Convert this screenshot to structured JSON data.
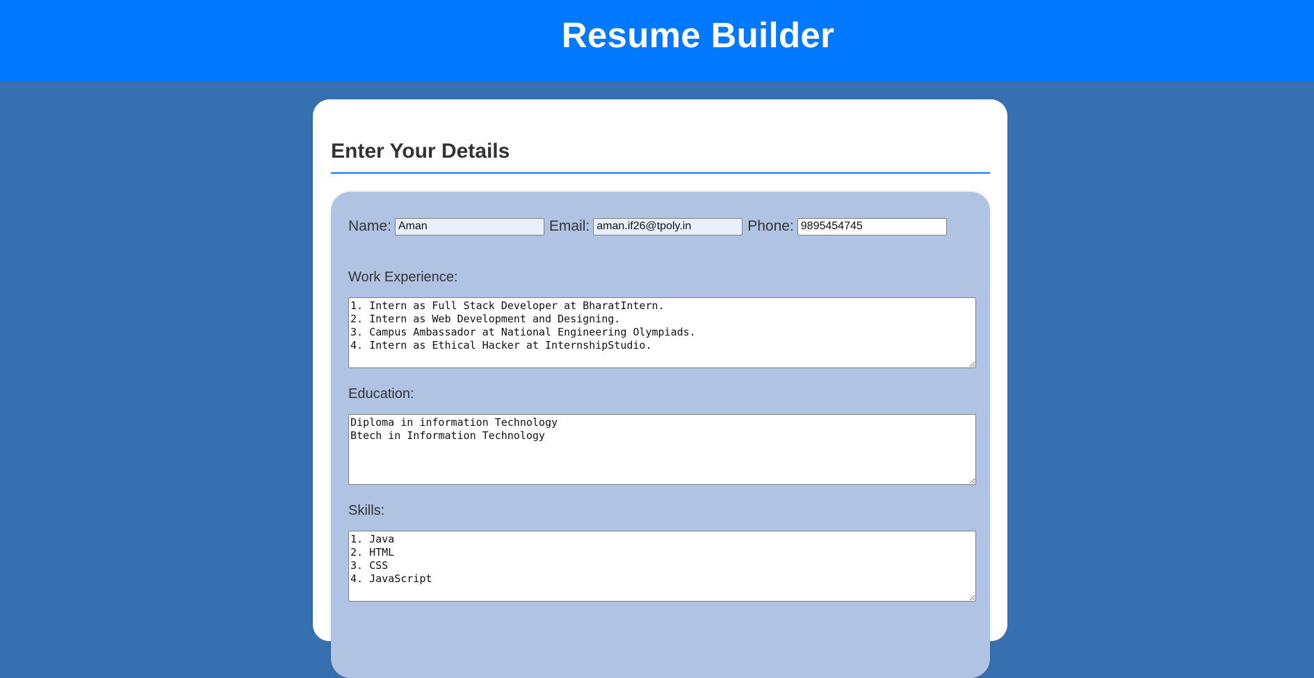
{
  "header": {
    "title": "Resume Builder"
  },
  "card": {
    "title": "Enter Your Details"
  },
  "form": {
    "name": {
      "label": "Name:",
      "value": "Aman"
    },
    "email": {
      "label": "Email:",
      "value": "aman.if26@tpoly.in"
    },
    "phone": {
      "label": "Phone:",
      "value": "9895454745"
    },
    "work_experience": {
      "label": "Work Experience:",
      "value": "1. Intern as Full Stack Developer at BharatIntern.\n2. Intern as Web Development and Designing.\n3. Campus Ambassador at National Engineering Olympiads.\n4. Intern as Ethical Hacker at InternshipStudio."
    },
    "education": {
      "label": "Education:",
      "value": "Diploma in information Technology\nBtech in Information Technology"
    },
    "skills": {
      "label": "Skills:",
      "value": "1. Java\n2. HTML\n3. CSS\n4. JavaScript"
    }
  },
  "colors": {
    "header_bg": "#0078ff",
    "page_bg": "#3670b0",
    "panel_bg": "#b1c3e2",
    "accent_rule": "#0078ff",
    "autofill_bg": "#e8f0fe"
  }
}
